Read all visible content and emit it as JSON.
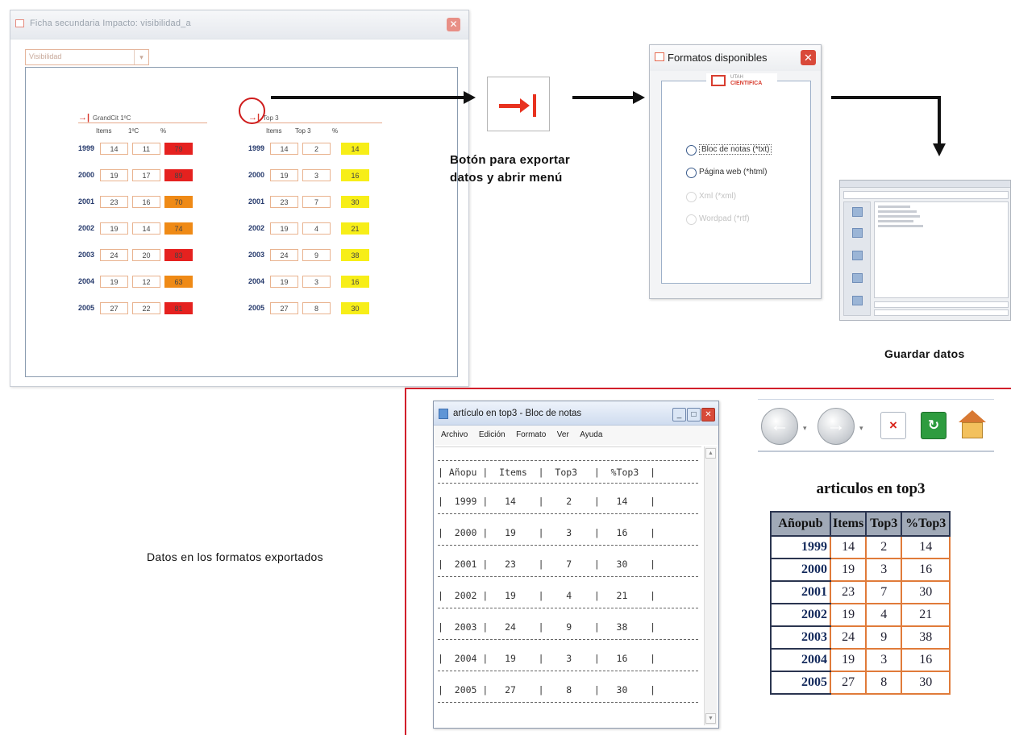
{
  "main_window": {
    "title": "Ficha secundaria Impacto: visibilidad_a",
    "close_icon": "close-icon",
    "select_value": "Visibilidad",
    "table_left": {
      "header": "GrandCit 1ºC",
      "columns": [
        "Items",
        "1ºC",
        "%"
      ],
      "rows": [
        {
          "year": "1999",
          "items": "14",
          "value": "11",
          "pct": "79",
          "color": "#e5211f"
        },
        {
          "year": "2000",
          "items": "19",
          "value": "17",
          "pct": "89",
          "color": "#e5211f"
        },
        {
          "year": "2001",
          "items": "23",
          "value": "16",
          "pct": "70",
          "color": "#ef8a16"
        },
        {
          "year": "2002",
          "items": "19",
          "value": "14",
          "pct": "74",
          "color": "#ef8a16"
        },
        {
          "year": "2003",
          "items": "24",
          "value": "20",
          "pct": "83",
          "color": "#e5211f"
        },
        {
          "year": "2004",
          "items": "19",
          "value": "12",
          "pct": "63",
          "color": "#ef8a16"
        },
        {
          "year": "2005",
          "items": "27",
          "value": "22",
          "pct": "81",
          "color": "#e5211f"
        }
      ]
    },
    "table_right": {
      "header": "Top 3",
      "columns": [
        "Items",
        "Top 3",
        "%"
      ],
      "rows": [
        {
          "year": "1999",
          "items": "14",
          "value": "2",
          "pct": "14",
          "color": "#f7ee18"
        },
        {
          "year": "2000",
          "items": "19",
          "value": "3",
          "pct": "16",
          "color": "#f7ee18"
        },
        {
          "year": "2001",
          "items": "23",
          "value": "7",
          "pct": "30",
          "color": "#f7ee18"
        },
        {
          "year": "2002",
          "items": "19",
          "value": "4",
          "pct": "21",
          "color": "#f7ee18"
        },
        {
          "year": "2003",
          "items": "24",
          "value": "9",
          "pct": "38",
          "color": "#f7ee18"
        },
        {
          "year": "2004",
          "items": "19",
          "value": "3",
          "pct": "16",
          "color": "#f7ee18"
        },
        {
          "year": "2005",
          "items": "27",
          "value": "8",
          "pct": "30",
          "color": "#f7ee18"
        }
      ]
    }
  },
  "export_caption": {
    "line1": "Botón para exportar",
    "line2": "datos y abrir menú"
  },
  "formats_dialog": {
    "title": "Formatos disponibles",
    "logo_top": "UTAH",
    "logo_bottom": "CIENTIFICA",
    "options": [
      {
        "label": "Bloc de notas (*txt)",
        "enabled": true
      },
      {
        "label": "Página web (*html)",
        "enabled": true
      },
      {
        "label": "Xml (*xml)",
        "enabled": false
      },
      {
        "label": "Wordpad (*rtf)",
        "enabled": false
      }
    ]
  },
  "save_caption": "Guardar datos",
  "formats_caption": "Datos en los formatos exportados",
  "notepad": {
    "title": "artículo en top3 - Bloc de notas",
    "menu": [
      "Archivo",
      "Edición",
      "Formato",
      "Ver",
      "Ayuda"
    ],
    "header_line": "| Añopu |  Items  |  Top3   |  %Top3  |",
    "lines": [
      "|  1999 |   14    |    2    |   14    |",
      "|  2000 |   19    |    3    |   16    |",
      "|  2001 |   23    |    7    |   30    |",
      "|  2002 |   19    |    4    |   21    |",
      "|  2003 |   24    |    9    |   38    |",
      "|  2004 |   19    |    3    |   16    |",
      "|  2005 |   27    |    8    |   30    |"
    ]
  },
  "browser": {
    "back_icon": "back-arrow-icon",
    "forward_icon": "forward-arrow-icon",
    "stop_icon": "stop-icon",
    "refresh_icon": "refresh-icon",
    "home_icon": "home-icon"
  },
  "html_table": {
    "title": "articulos en top3",
    "headers": [
      "Añopub",
      "Items",
      "Top3",
      "%Top3"
    ],
    "rows": [
      [
        "1999",
        "14",
        "2",
        "14"
      ],
      [
        "2000",
        "19",
        "3",
        "16"
      ],
      [
        "2001",
        "23",
        "7",
        "30"
      ],
      [
        "2002",
        "19",
        "4",
        "21"
      ],
      [
        "2003",
        "24",
        "9",
        "38"
      ],
      [
        "2004",
        "19",
        "3",
        "16"
      ],
      [
        "2005",
        "27",
        "8",
        "30"
      ]
    ]
  }
}
